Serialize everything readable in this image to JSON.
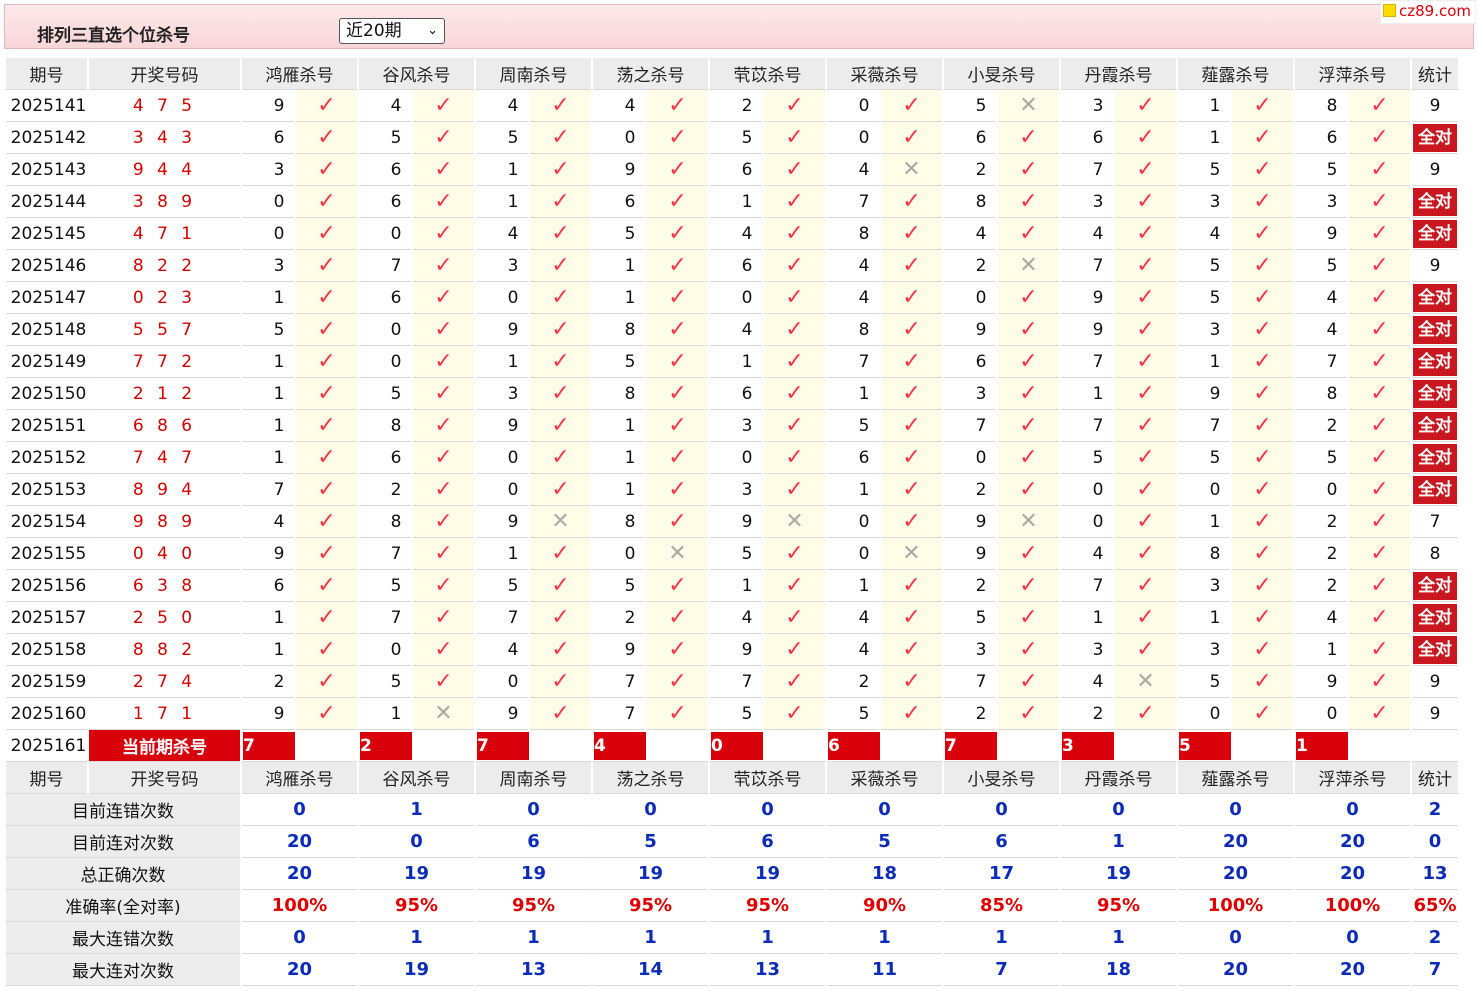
{
  "topbar": {
    "title": "排列三直选个位杀号",
    "period": "近20期",
    "badge": "cz89.com"
  },
  "headers": [
    "期号",
    "开奖号码",
    "鸿雁杀号",
    "谷风杀号",
    "周南杀号",
    "荡之杀号",
    "茕苡杀号",
    "采薇杀号",
    "小旻杀号",
    "丹霞杀号",
    "薤露杀号",
    "浮萍杀号",
    "统计"
  ],
  "rows": [
    {
      "issue": "2025141",
      "draw": "4 7 5",
      "k": [
        [
          9,
          1
        ],
        [
          4,
          1
        ],
        [
          4,
          1
        ],
        [
          4,
          1
        ],
        [
          2,
          1
        ],
        [
          0,
          1
        ],
        [
          5,
          0
        ],
        [
          3,
          1
        ],
        [
          1,
          1
        ],
        [
          8,
          1
        ]
      ],
      "stat": "9"
    },
    {
      "issue": "2025142",
      "draw": "3 4 3",
      "k": [
        [
          6,
          1
        ],
        [
          5,
          1
        ],
        [
          5,
          1
        ],
        [
          0,
          1
        ],
        [
          5,
          1
        ],
        [
          0,
          1
        ],
        [
          6,
          1
        ],
        [
          6,
          1
        ],
        [
          1,
          1
        ],
        [
          6,
          1
        ]
      ],
      "stat": "全对"
    },
    {
      "issue": "2025143",
      "draw": "9 4 4",
      "k": [
        [
          3,
          1
        ],
        [
          6,
          1
        ],
        [
          1,
          1
        ],
        [
          9,
          1
        ],
        [
          6,
          1
        ],
        [
          4,
          0
        ],
        [
          2,
          1
        ],
        [
          7,
          1
        ],
        [
          5,
          1
        ],
        [
          5,
          1
        ]
      ],
      "stat": "9"
    },
    {
      "issue": "2025144",
      "draw": "3 8 9",
      "k": [
        [
          0,
          1
        ],
        [
          6,
          1
        ],
        [
          1,
          1
        ],
        [
          6,
          1
        ],
        [
          1,
          1
        ],
        [
          7,
          1
        ],
        [
          8,
          1
        ],
        [
          3,
          1
        ],
        [
          3,
          1
        ],
        [
          3,
          1
        ]
      ],
      "stat": "全对"
    },
    {
      "issue": "2025145",
      "draw": "4 7 1",
      "k": [
        [
          0,
          1
        ],
        [
          0,
          1
        ],
        [
          4,
          1
        ],
        [
          5,
          1
        ],
        [
          4,
          1
        ],
        [
          8,
          1
        ],
        [
          4,
          1
        ],
        [
          4,
          1
        ],
        [
          4,
          1
        ],
        [
          9,
          1
        ]
      ],
      "stat": "全对"
    },
    {
      "issue": "2025146",
      "draw": "8 2 2",
      "k": [
        [
          3,
          1
        ],
        [
          7,
          1
        ],
        [
          3,
          1
        ],
        [
          1,
          1
        ],
        [
          6,
          1
        ],
        [
          4,
          1
        ],
        [
          2,
          0
        ],
        [
          7,
          1
        ],
        [
          5,
          1
        ],
        [
          5,
          1
        ]
      ],
      "stat": "9"
    },
    {
      "issue": "2025147",
      "draw": "0 2 3",
      "k": [
        [
          1,
          1
        ],
        [
          6,
          1
        ],
        [
          0,
          1
        ],
        [
          1,
          1
        ],
        [
          0,
          1
        ],
        [
          4,
          1
        ],
        [
          0,
          1
        ],
        [
          9,
          1
        ],
        [
          5,
          1
        ],
        [
          4,
          1
        ]
      ],
      "stat": "全对"
    },
    {
      "issue": "2025148",
      "draw": "5 5 7",
      "k": [
        [
          5,
          1
        ],
        [
          0,
          1
        ],
        [
          9,
          1
        ],
        [
          8,
          1
        ],
        [
          4,
          1
        ],
        [
          8,
          1
        ],
        [
          9,
          1
        ],
        [
          9,
          1
        ],
        [
          3,
          1
        ],
        [
          4,
          1
        ]
      ],
      "stat": "全对"
    },
    {
      "issue": "2025149",
      "draw": "7 7 2",
      "k": [
        [
          1,
          1
        ],
        [
          0,
          1
        ],
        [
          1,
          1
        ],
        [
          5,
          1
        ],
        [
          1,
          1
        ],
        [
          7,
          1
        ],
        [
          6,
          1
        ],
        [
          7,
          1
        ],
        [
          1,
          1
        ],
        [
          7,
          1
        ]
      ],
      "stat": "全对"
    },
    {
      "issue": "2025150",
      "draw": "2 1 2",
      "k": [
        [
          1,
          1
        ],
        [
          5,
          1
        ],
        [
          3,
          1
        ],
        [
          8,
          1
        ],
        [
          6,
          1
        ],
        [
          1,
          1
        ],
        [
          3,
          1
        ],
        [
          1,
          1
        ],
        [
          9,
          1
        ],
        [
          8,
          1
        ]
      ],
      "stat": "全对"
    },
    {
      "issue": "2025151",
      "draw": "6 8 6",
      "k": [
        [
          1,
          1
        ],
        [
          8,
          1
        ],
        [
          9,
          1
        ],
        [
          1,
          1
        ],
        [
          3,
          1
        ],
        [
          5,
          1
        ],
        [
          7,
          1
        ],
        [
          7,
          1
        ],
        [
          7,
          1
        ],
        [
          2,
          1
        ]
      ],
      "stat": "全对"
    },
    {
      "issue": "2025152",
      "draw": "7 4 7",
      "k": [
        [
          1,
          1
        ],
        [
          6,
          1
        ],
        [
          0,
          1
        ],
        [
          1,
          1
        ],
        [
          0,
          1
        ],
        [
          6,
          1
        ],
        [
          0,
          1
        ],
        [
          5,
          1
        ],
        [
          5,
          1
        ],
        [
          5,
          1
        ]
      ],
      "stat": "全对"
    },
    {
      "issue": "2025153",
      "draw": "8 9 4",
      "k": [
        [
          7,
          1
        ],
        [
          2,
          1
        ],
        [
          0,
          1
        ],
        [
          1,
          1
        ],
        [
          3,
          1
        ],
        [
          1,
          1
        ],
        [
          2,
          1
        ],
        [
          0,
          1
        ],
        [
          0,
          1
        ],
        [
          0,
          1
        ]
      ],
      "stat": "全对"
    },
    {
      "issue": "2025154",
      "draw": "9 8 9",
      "k": [
        [
          4,
          1
        ],
        [
          8,
          1
        ],
        [
          9,
          0
        ],
        [
          8,
          1
        ],
        [
          9,
          0
        ],
        [
          0,
          1
        ],
        [
          9,
          0
        ],
        [
          0,
          1
        ],
        [
          1,
          1
        ],
        [
          2,
          1
        ]
      ],
      "stat": "7"
    },
    {
      "issue": "2025155",
      "draw": "0 4 0",
      "k": [
        [
          9,
          1
        ],
        [
          7,
          1
        ],
        [
          1,
          1
        ],
        [
          0,
          0
        ],
        [
          5,
          1
        ],
        [
          0,
          0
        ],
        [
          9,
          1
        ],
        [
          4,
          1
        ],
        [
          8,
          1
        ],
        [
          2,
          1
        ]
      ],
      "stat": "8"
    },
    {
      "issue": "2025156",
      "draw": "6 3 8",
      "k": [
        [
          6,
          1
        ],
        [
          5,
          1
        ],
        [
          5,
          1
        ],
        [
          5,
          1
        ],
        [
          1,
          1
        ],
        [
          1,
          1
        ],
        [
          2,
          1
        ],
        [
          7,
          1
        ],
        [
          3,
          1
        ],
        [
          2,
          1
        ]
      ],
      "stat": "全对"
    },
    {
      "issue": "2025157",
      "draw": "2 5 0",
      "k": [
        [
          1,
          1
        ],
        [
          7,
          1
        ],
        [
          7,
          1
        ],
        [
          2,
          1
        ],
        [
          4,
          1
        ],
        [
          4,
          1
        ],
        [
          5,
          1
        ],
        [
          1,
          1
        ],
        [
          1,
          1
        ],
        [
          4,
          1
        ]
      ],
      "stat": "全对"
    },
    {
      "issue": "2025158",
      "draw": "8 8 2",
      "k": [
        [
          1,
          1
        ],
        [
          0,
          1
        ],
        [
          4,
          1
        ],
        [
          9,
          1
        ],
        [
          9,
          1
        ],
        [
          4,
          1
        ],
        [
          3,
          1
        ],
        [
          3,
          1
        ],
        [
          3,
          1
        ],
        [
          1,
          1
        ]
      ],
      "stat": "全对"
    },
    {
      "issue": "2025159",
      "draw": "2 7 4",
      "k": [
        [
          2,
          1
        ],
        [
          5,
          1
        ],
        [
          0,
          1
        ],
        [
          7,
          1
        ],
        [
          7,
          1
        ],
        [
          2,
          1
        ],
        [
          7,
          1
        ],
        [
          4,
          0
        ],
        [
          5,
          1
        ],
        [
          9,
          1
        ]
      ],
      "stat": "9"
    },
    {
      "issue": "2025160",
      "draw": "1 7 1",
      "k": [
        [
          9,
          1
        ],
        [
          1,
          0
        ],
        [
          9,
          1
        ],
        [
          7,
          1
        ],
        [
          5,
          1
        ],
        [
          5,
          1
        ],
        [
          2,
          1
        ],
        [
          2,
          1
        ],
        [
          0,
          1
        ],
        [
          0,
          1
        ]
      ],
      "stat": "9"
    }
  ],
  "current": {
    "issue": "2025161",
    "label": "当前期杀号",
    "kills": [
      "7",
      "2",
      "7",
      "4",
      "0",
      "6",
      "7",
      "3",
      "5",
      "1"
    ]
  },
  "summary": [
    {
      "label": "目前连错次数",
      "values": [
        "0",
        "1",
        "0",
        "0",
        "0",
        "0",
        "0",
        "0",
        "0",
        "0",
        "2"
      ]
    },
    {
      "label": "目前连对次数",
      "values": [
        "20",
        "0",
        "6",
        "5",
        "6",
        "5",
        "6",
        "1",
        "20",
        "20",
        "0"
      ]
    },
    {
      "label": "总正确次数",
      "values": [
        "20",
        "19",
        "19",
        "19",
        "19",
        "18",
        "17",
        "19",
        "20",
        "20",
        "13"
      ]
    },
    {
      "label": "准确率(全对率)",
      "values": [
        "100%",
        "95%",
        "95%",
        "95%",
        "95%",
        "90%",
        "85%",
        "95%",
        "100%",
        "100%",
        "65%"
      ],
      "pct": true
    },
    {
      "label": "最大连错次数",
      "values": [
        "0",
        "1",
        "1",
        "1",
        "1",
        "1",
        "1",
        "1",
        "0",
        "0",
        "2"
      ]
    },
    {
      "label": "最大连对次数",
      "values": [
        "20",
        "19",
        "13",
        "14",
        "13",
        "11",
        "7",
        "18",
        "20",
        "20",
        "7"
      ]
    }
  ],
  "marks": {
    "ok": "✓",
    "bad": "✕",
    "caret": "⌄"
  }
}
